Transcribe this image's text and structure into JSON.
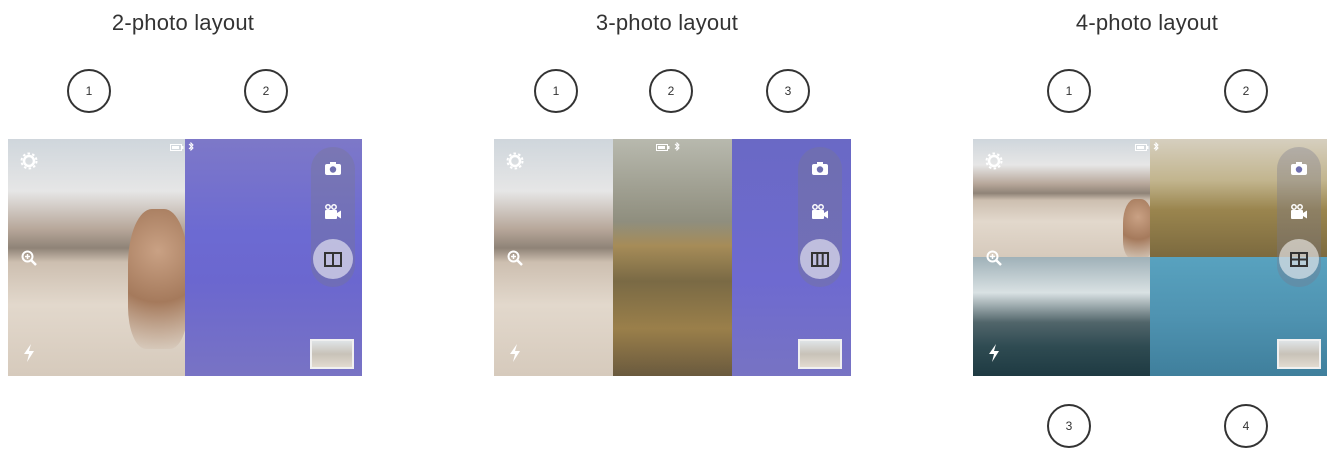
{
  "layouts": [
    {
      "title": "2-photo layout",
      "numbers": [
        "1",
        "2"
      ]
    },
    {
      "title": "3-photo layout",
      "numbers": [
        "1",
        "2",
        "3"
      ]
    },
    {
      "title": "4-photo layout",
      "numbers": [
        "1",
        "2",
        "3",
        "4"
      ]
    }
  ],
  "icons": {
    "settings": "gear-icon",
    "zoom": "zoom-icon",
    "flash": "flash-icon",
    "camera": "camera-icon",
    "video": "video-icon",
    "battery": "battery-icon",
    "bluetooth": "bluetooth-icon"
  }
}
